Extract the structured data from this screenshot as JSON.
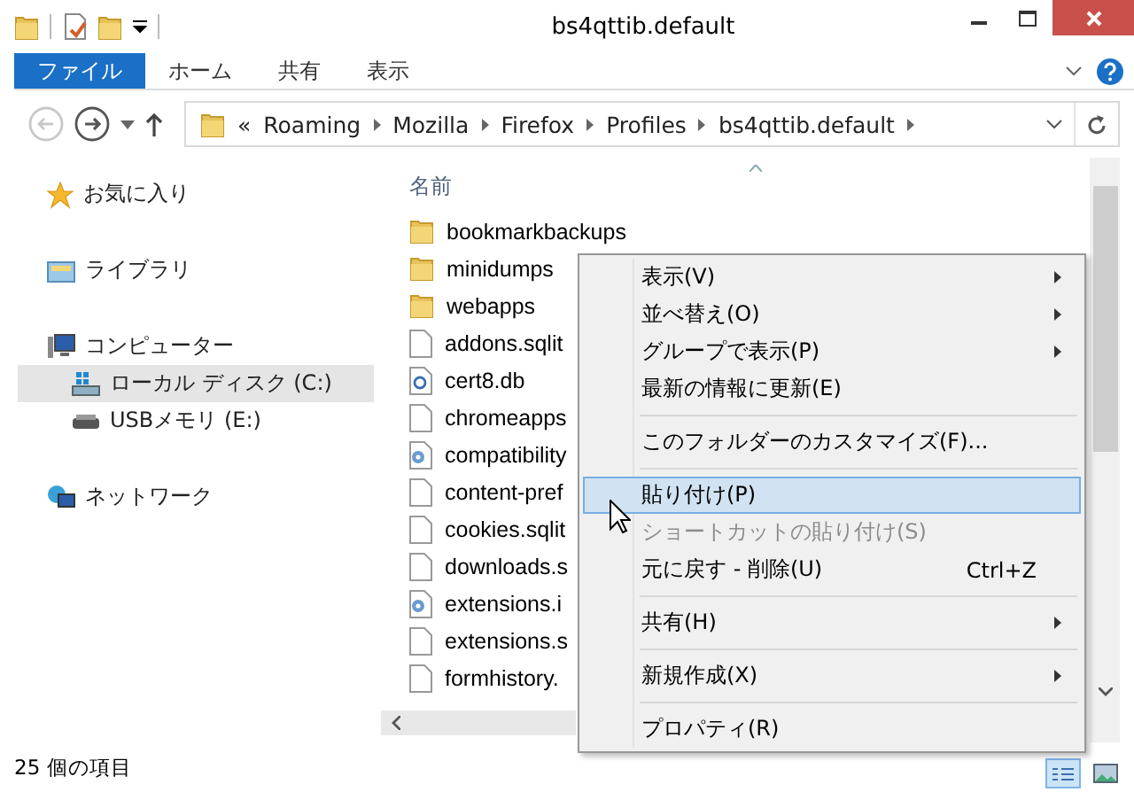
{
  "window": {
    "title": "bs4qttib.default"
  },
  "ribbon": {
    "tabs": [
      {
        "label": "ファイル",
        "selected": true
      },
      {
        "label": "ホーム",
        "selected": false
      },
      {
        "label": "共有",
        "selected": false
      },
      {
        "label": "表示",
        "selected": false
      }
    ]
  },
  "address": {
    "overflow": "«",
    "crumbs": [
      "Roaming",
      "Mozilla",
      "Firefox",
      "Profiles",
      "bs4qttib.default"
    ],
    "back_disabled": true
  },
  "sidebar": {
    "items": [
      {
        "label": "お気に入り",
        "kind": "star",
        "selected": false
      },
      {
        "label": "ライブラリ",
        "kind": "library",
        "selected": false
      },
      {
        "label": "コンピューター",
        "kind": "computer",
        "selected": false,
        "children": [
          {
            "label": "ローカル ディスク (C:)",
            "kind": "disk",
            "selected": true
          },
          {
            "label": "USBメモリ (E:)",
            "kind": "usb",
            "selected": false
          }
        ]
      },
      {
        "label": "ネットワーク",
        "kind": "network",
        "selected": false
      }
    ]
  },
  "file_list": {
    "column": "名前",
    "files": [
      {
        "name": "bookmarkbackups",
        "kind": "folder"
      },
      {
        "name": "minidumps",
        "kind": "folder"
      },
      {
        "name": "webapps",
        "kind": "folder"
      },
      {
        "name": "addons.sqlit",
        "kind": "file"
      },
      {
        "name": "cert8.db",
        "kind": "cert"
      },
      {
        "name": "chromeapps",
        "kind": "file"
      },
      {
        "name": "compatibility",
        "kind": "config"
      },
      {
        "name": "content-pref",
        "kind": "file"
      },
      {
        "name": "cookies.sqlit",
        "kind": "file"
      },
      {
        "name": "downloads.s",
        "kind": "file"
      },
      {
        "name": "extensions.i",
        "kind": "config"
      },
      {
        "name": "extensions.s",
        "kind": "file"
      },
      {
        "name": "formhistory.",
        "kind": "file"
      }
    ]
  },
  "context_menu": {
    "items": [
      {
        "kind": "item",
        "label": "表示(V)",
        "submenu": true,
        "selected": false,
        "disabled": false
      },
      {
        "kind": "item",
        "label": "並べ替え(O)",
        "submenu": true,
        "selected": false,
        "disabled": false
      },
      {
        "kind": "item",
        "label": "グループで表示(P)",
        "submenu": true,
        "selected": false,
        "disabled": false
      },
      {
        "kind": "item",
        "label": "最新の情報に更新(E)",
        "submenu": false,
        "selected": false,
        "disabled": false
      },
      {
        "kind": "separator"
      },
      {
        "kind": "item",
        "label": "このフォルダーのカスタマイズ(F)...",
        "submenu": false,
        "selected": false,
        "disabled": false
      },
      {
        "kind": "separator"
      },
      {
        "kind": "item",
        "label": "貼り付け(P)",
        "submenu": false,
        "selected": true,
        "disabled": false
      },
      {
        "kind": "item",
        "label": "ショートカットの貼り付け(S)",
        "submenu": false,
        "selected": false,
        "disabled": true
      },
      {
        "kind": "item",
        "label": "元に戻す - 削除(U)",
        "shortcut": "Ctrl+Z",
        "submenu": false,
        "selected": false,
        "disabled": false
      },
      {
        "kind": "separator"
      },
      {
        "kind": "item",
        "label": "共有(H)",
        "submenu": true,
        "selected": false,
        "disabled": false
      },
      {
        "kind": "separator"
      },
      {
        "kind": "item",
        "label": "新規作成(X)",
        "submenu": true,
        "selected": false,
        "disabled": false
      },
      {
        "kind": "separator"
      },
      {
        "kind": "item",
        "label": "プロパティ(R)",
        "submenu": false,
        "selected": false,
        "disabled": false
      }
    ]
  },
  "status_bar": {
    "text": "25 個の項目",
    "views": [
      {
        "kind": "details",
        "selected": true
      },
      {
        "kind": "icons",
        "selected": false
      }
    ]
  }
}
